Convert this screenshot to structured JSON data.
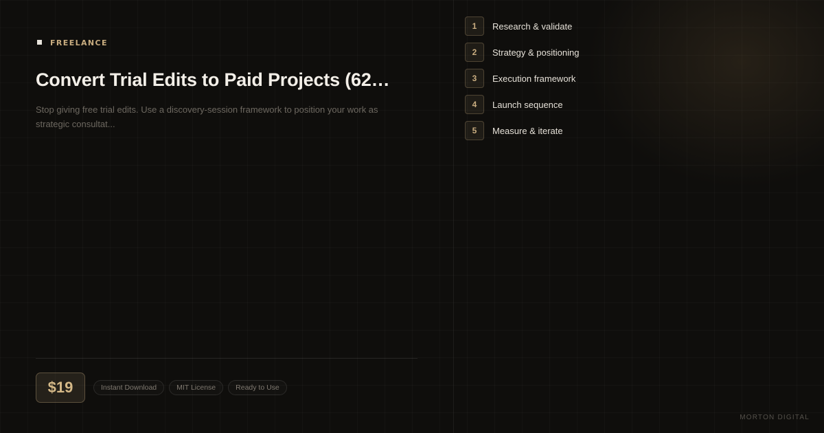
{
  "category": "FREELANCE",
  "title": "Convert Trial Edits to Paid Projects (62…",
  "description": "Stop giving free trial edits. Use a discovery-session framework to position your work as strategic consultat...",
  "price": "$19",
  "badges": [
    "Instant Download",
    "MIT License",
    "Ready to Use"
  ],
  "steps": [
    {
      "num": "1",
      "label": "Research & validate"
    },
    {
      "num": "2",
      "label": "Strategy & positioning"
    },
    {
      "num": "3",
      "label": "Execution framework"
    },
    {
      "num": "4",
      "label": "Launch sequence"
    },
    {
      "num": "5",
      "label": "Measure & iterate"
    }
  ],
  "brand": "MORTON DIGITAL",
  "colors": {
    "accent": "#c9ad80",
    "background": "#0f0e0c",
    "title": "#f3efe8"
  }
}
